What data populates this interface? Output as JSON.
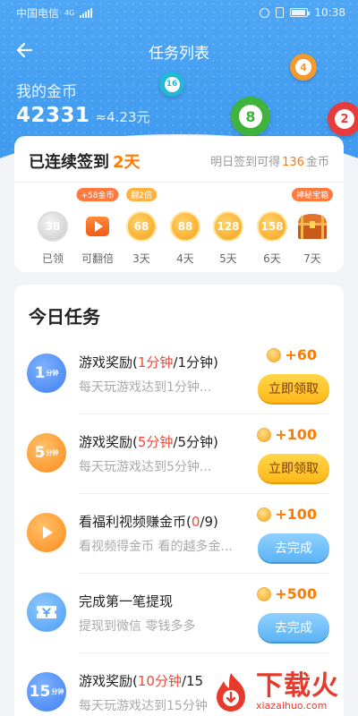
{
  "status_bar": {
    "carrier": "中国电信",
    "network": "4G",
    "time": "10:38",
    "battery_level": 0.9
  },
  "header": {
    "title": "任务列表"
  },
  "gold": {
    "label": "我的金币",
    "amount": "42331",
    "yuan": "≈4.23元"
  },
  "balls": [
    {
      "number": "16",
      "color": "#22b8d8"
    },
    {
      "number": "4",
      "color": "#f29a2e"
    },
    {
      "number": "8",
      "color": "#3fb33a"
    },
    {
      "number": "2",
      "color": "#e83b3b"
    }
  ],
  "signin": {
    "title_prefix": "已连续签到",
    "streak": "2天",
    "hint_prefix": "明日签到可得",
    "hint_amount": "136",
    "hint_suffix": "金币",
    "days": [
      {
        "label": "已领",
        "value": "38",
        "style": "grey",
        "tag": ""
      },
      {
        "label": "可翻倍",
        "value": "",
        "style": "play",
        "tag": "+58金币"
      },
      {
        "label": "3天",
        "value": "68",
        "style": "gold",
        "tag": "翻2倍"
      },
      {
        "label": "4天",
        "value": "88",
        "style": "gold",
        "tag": ""
      },
      {
        "label": "5天",
        "value": "128",
        "style": "gold",
        "tag": ""
      },
      {
        "label": "6天",
        "value": "158",
        "style": "gold",
        "tag": ""
      },
      {
        "label": "7天",
        "value": "",
        "style": "chest",
        "tag": "神秘宝箱"
      }
    ]
  },
  "tasks": {
    "title": "今日任务",
    "items": [
      {
        "icon_num": "1",
        "icon_unit": "分钟",
        "icon_style": "ic-blue",
        "title_prefix": "游戏奖励(",
        "title_progress": "1分钟",
        "title_suffix": "/1分钟)",
        "desc": "每天玩游戏达到1分钟...",
        "reward": "+60",
        "button": "立即领取",
        "button_style": "btn-claim"
      },
      {
        "icon_num": "5",
        "icon_unit": "分钟",
        "icon_style": "ic-orange",
        "title_prefix": "游戏奖励(",
        "title_progress": "5分钟",
        "title_suffix": "/5分钟)",
        "desc": "每天玩游戏达到5分钟...",
        "reward": "+100",
        "button": "立即领取",
        "button_style": "btn-claim"
      },
      {
        "icon_num": "",
        "icon_unit": "",
        "icon_style": "ic-orange",
        "title_prefix": "看福利视频赚金币(",
        "title_progress": "0",
        "title_suffix": "/9)",
        "desc": "看视频得金币 看的越多金...",
        "reward": "+100",
        "button": "去完成",
        "button_style": "btn-go"
      },
      {
        "icon_num": "",
        "icon_unit": "",
        "icon_style": "ic-lblue",
        "title_prefix": "完成第一笔提现",
        "title_progress": "",
        "title_suffix": "",
        "desc": "提现到微信 零钱多多",
        "reward": "+500",
        "button": "去完成",
        "button_style": "btn-go"
      },
      {
        "icon_num": "15",
        "icon_unit": "分钟",
        "icon_style": "ic-blue",
        "title_prefix": "游戏奖励(",
        "title_progress": "10分钟",
        "title_suffix": "/15",
        "desc": "每天玩游戏达到15分钟",
        "reward": "",
        "button": "",
        "button_style": ""
      }
    ]
  },
  "watermark": {
    "text": "下载火",
    "url": "xiazaihuo.com"
  }
}
